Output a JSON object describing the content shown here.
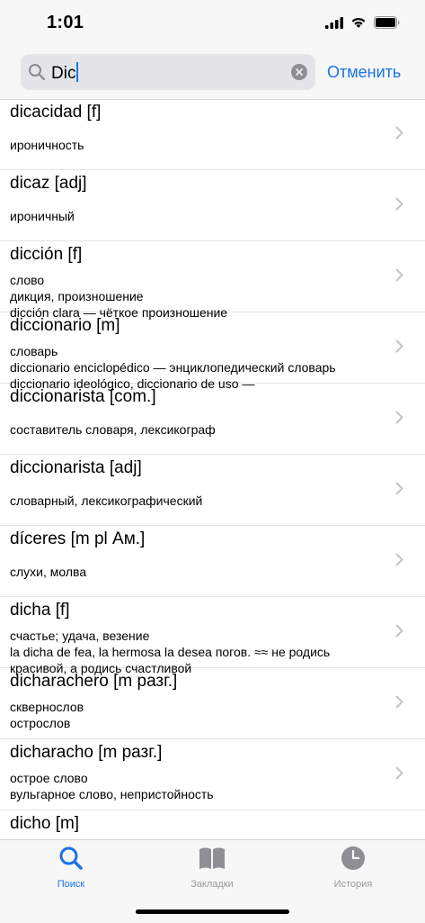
{
  "status": {
    "time": "1:01"
  },
  "search": {
    "value": "Dic",
    "cancel_label": "Отменить"
  },
  "results": [
    {
      "head": "dicacidad [f]",
      "lines": [
        "ироничность"
      ]
    },
    {
      "head": "dicaz [adj]",
      "lines": [
        "ироничный"
      ]
    },
    {
      "head": "dicción [f]",
      "lines": [
        "слово",
        "дикция, произношение",
        "dicción clara — чёткое произношение"
      ]
    },
    {
      "head": "diccionario [m]",
      "lines": [
        "словарь",
        "diccionario enciclopédico — энциклопедический словарь",
        "diccionario ideológico, diccionario de uso —"
      ]
    },
    {
      "head": "diccionarista [com.]",
      "lines": [
        "составитель словаря, лексикограф"
      ]
    },
    {
      "head": "diccionarista [adj]",
      "lines": [
        "словарный, лексикографический"
      ]
    },
    {
      "head": "díceres [m pl Ам.]",
      "lines": [
        "слухи, молва"
      ]
    },
    {
      "head": "dicha [f]",
      "lines": [
        "счастье; удача, везение",
        "la dicha de fea, la hermosa la desea погов. ≈≈ не родись",
        "красивой, а родись счастливой"
      ]
    },
    {
      "head": "dicharachero [m разг.]",
      "lines": [
        "сквернослов",
        "острослов"
      ]
    },
    {
      "head": "dicharacho [m разг.]",
      "lines": [
        "острое слово",
        "вульгарное слово, непристойность"
      ]
    },
    {
      "head": "dicho [m]",
      "lines": []
    }
  ],
  "tabs": [
    {
      "label": "Поиск",
      "icon": "search-icon",
      "active": true
    },
    {
      "label": "Закладки",
      "icon": "book-icon",
      "active": false
    },
    {
      "label": "История",
      "icon": "clock-icon",
      "active": false
    }
  ],
  "colors": {
    "accent": "#1a73e8",
    "inactive": "#999999"
  }
}
